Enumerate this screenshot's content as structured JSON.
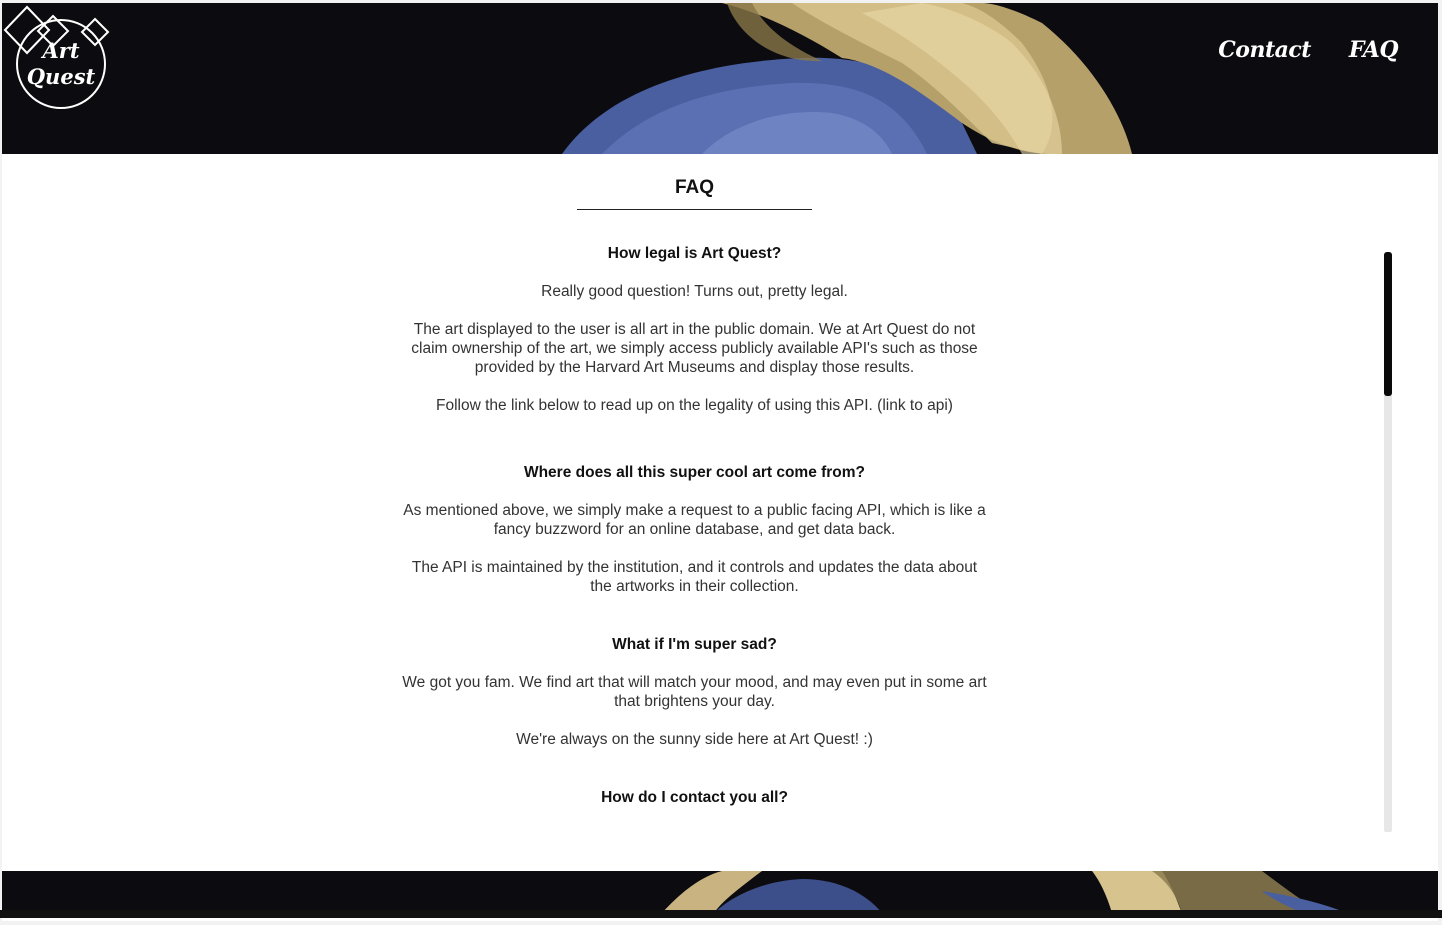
{
  "header": {
    "logo_line1": "Art",
    "logo_line2": "Quest",
    "nav": [
      {
        "label": "Contact"
      },
      {
        "label": "FAQ"
      }
    ]
  },
  "faq": {
    "title": "FAQ",
    "entries": [
      {
        "question": "How legal is Art Quest?",
        "answers": [
          "Really good question! Turns out, pretty legal.",
          "The art displayed to the user is all art in the public domain. We at Art Quest do not claim ownership of the art, we simply access publicly available API's such as those provided by the Harvard Art Museums and display those results.",
          "Follow the link below to read up on the legality of using this API. (link to api)"
        ]
      },
      {
        "question": "Where does all this super cool art come from?",
        "answers": [
          "As mentioned above, we simply make a request to a public facing API, which is like a fancy buzzword for an online database, and get data back.",
          "The API is maintained by the institution, and it controls and updates the data about the artworks in their collection."
        ]
      },
      {
        "question": "What if I'm super sad?",
        "answers": [
          "We got you fam. We find art that will match your mood, and may even put in some art that brightens your day.",
          "We're always on the sunny side here at Art Quest! :)"
        ]
      },
      {
        "question": "How do I contact you all?",
        "answers": []
      }
    ]
  },
  "colors": {
    "band_background": "#0c0c10",
    "text": "#333333",
    "scrollbar_thumb": "#0a0a0a",
    "scrollbar_track": "#e7e7e7"
  },
  "icons": [
    "diamond-icon",
    "diamond-icon",
    "diamond-icon"
  ]
}
